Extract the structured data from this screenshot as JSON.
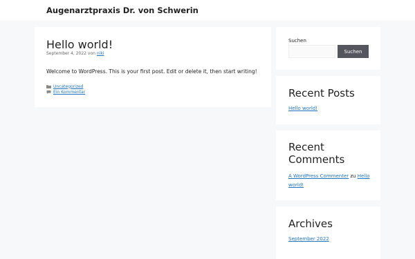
{
  "site": {
    "title": "Augenarztpraxis Dr. von Schwerin"
  },
  "post": {
    "title": "Hello world!",
    "date": "September 4, 2022",
    "by": "von",
    "author": "niki",
    "body": "Welcome to WordPress. This is your first post. Edit or delete it, then start writing!",
    "category": "Uncategorized",
    "comment_link": "Ein Kommentar"
  },
  "sidebar": {
    "search": {
      "label": "Suchen",
      "button": "Suchen",
      "placeholder": ""
    },
    "recent_posts": {
      "title": "Recent Posts",
      "items": [
        "Hello world!"
      ]
    },
    "recent_comments": {
      "title": "Recent Comments",
      "author": "A WordPress Commenter",
      "connector": "zu",
      "post": "Hello world!"
    },
    "archives": {
      "title": "Archives",
      "items": [
        "September 2022"
      ]
    }
  },
  "colors": {
    "background": "#f7f8f9",
    "link": "#1e73be",
    "button": "#55555e"
  },
  "icons": [
    "folder-icon",
    "comment-icon"
  ]
}
